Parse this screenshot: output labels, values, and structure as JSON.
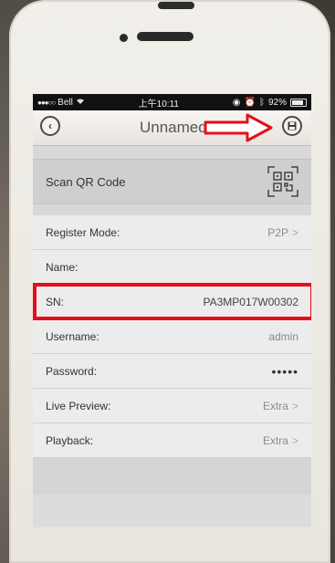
{
  "status_bar": {
    "carrier": "Bell",
    "time": "上午10:11",
    "battery": "92%"
  },
  "nav": {
    "title": "Unnamed",
    "back_icon": "chevron-left-icon",
    "save_icon": "save-disk-icon"
  },
  "qr": {
    "label": "Scan QR Code",
    "icon": "qr-code-icon"
  },
  "fields": {
    "register_mode": {
      "label": "Register Mode:",
      "value": "P2P"
    },
    "name": {
      "label": "Name:",
      "value": ""
    },
    "sn": {
      "label": "SN:",
      "value": "PA3MP017W00302"
    },
    "username": {
      "label": "Username:",
      "value": "admin"
    },
    "password": {
      "label": "Password:",
      "value": "•••••"
    },
    "live_preview": {
      "label": "Live Preview:",
      "value": "Extra"
    },
    "playback": {
      "label": "Playback:",
      "value": "Extra"
    }
  },
  "colors": {
    "highlight": "#e50f1b",
    "row_bg": "#ececec",
    "navbar_bg": "#f3eeea"
  }
}
